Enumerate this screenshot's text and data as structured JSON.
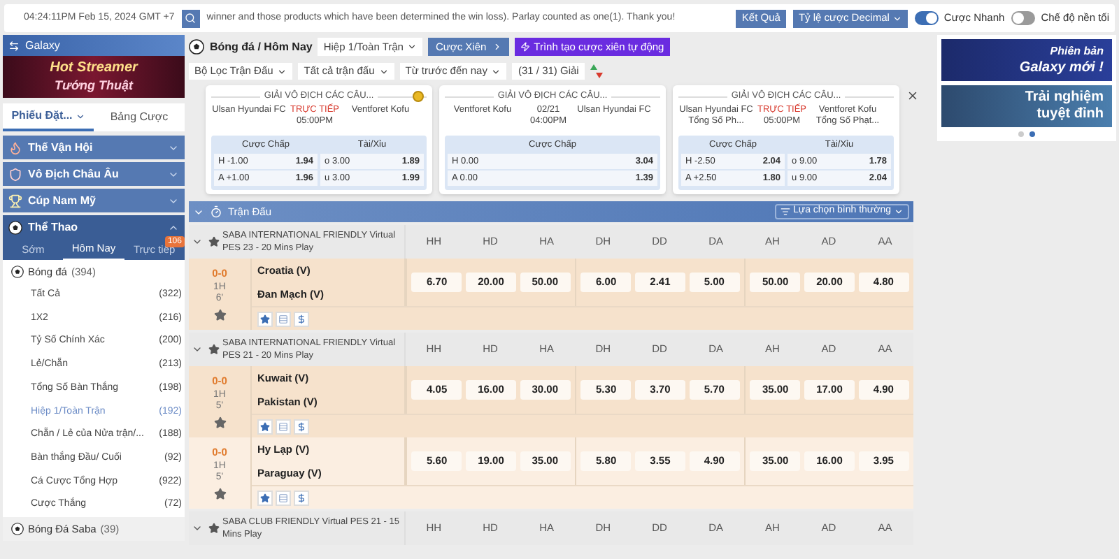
{
  "top_bar": {
    "time": "04:24:11PM Feb 15, 2024 GMT +7",
    "marquee": "winner and those products which have been determined the win loss). Parlay counted as one(1). Thank you!",
    "results_button": "Kết Quả",
    "odds_format": "Tỷ lệ cược Decimal",
    "toggles": [
      {
        "label": "Cược Nhanh",
        "on": true
      },
      {
        "label": "Chế độ nền tối",
        "on": false
      }
    ]
  },
  "left_banners": {
    "galaxy": "Galaxy",
    "streamer_line_1": "Hot Streamer",
    "streamer_line_2": "Tướng Thuật"
  },
  "sidebar": {
    "tabs": [
      {
        "label": "Phiếu Đặt...",
        "selected": true,
        "dropdown": true
      },
      {
        "label": "Bảng Cược",
        "selected": false,
        "dropdown": false
      }
    ],
    "sections": [
      {
        "label": "Thế Vận Hội",
        "kind": "flame",
        "expanded": false
      },
      {
        "label": "Vô Địch Châu Âu",
        "kind": "shield",
        "expanded": false
      },
      {
        "label": "Cúp Nam Mỹ",
        "kind": "trophy",
        "expanded": false
      },
      {
        "label": "Thể Thao",
        "kind": "ball",
        "expanded": true
      }
    ],
    "sport_tabs": [
      {
        "label": "Sớm",
        "selected": false
      },
      {
        "label": "Hôm Nay",
        "selected": true
      },
      {
        "label": "Trực tiếp",
        "selected": false,
        "badge": "106"
      }
    ],
    "sports": [
      {
        "label": "Bóng đá",
        "count": "(394)",
        "expanded": true,
        "children": [
          {
            "label": "Tất Cả",
            "count": "(322)",
            "selected": false
          },
          {
            "label": "1X2",
            "count": "(216)",
            "selected": false
          },
          {
            "label": "Tỷ Số Chính Xác",
            "count": "(200)",
            "selected": false
          },
          {
            "label": "Lẻ/Chẵn",
            "count": "(213)",
            "selected": false
          },
          {
            "label": "Tổng Số Bàn Thắng",
            "count": "(198)",
            "selected": false
          },
          {
            "label": "Hiệp 1/Toàn Trận",
            "count": "(192)",
            "selected": true
          },
          {
            "label": "Chẵn / Lẻ của Nửa trận/...",
            "count": "(188)",
            "selected": false
          },
          {
            "label": "Bàn thắng Đầu/ Cuối",
            "count": "(92)",
            "selected": false
          },
          {
            "label": "Cá Cược Tổng Hợp",
            "count": "(922)",
            "selected": false
          },
          {
            "label": "Cược Thắng",
            "count": "(72)",
            "selected": false
          }
        ]
      },
      {
        "label": "Bóng Đá Saba",
        "count": "(39)",
        "expanded": false
      }
    ]
  },
  "toolbar": {
    "breadcrumb": "Bóng đá / Hôm Nay",
    "period_select": "Hiệp 1/Toàn Trận",
    "parlay_button": "Cược Xiên",
    "auto_parlay_button": "Trình tạo cược xiên tự động"
  },
  "filters": [
    "Bộ Lọc Trận Đấu",
    "Tất cả trận đấu",
    "Từ trước đến nay"
  ],
  "league_count": "(31 / 31) Giải",
  "featured": [
    {
      "league": "GIẢI VÔ ĐỊCH CÁC CÂU...",
      "coin": true,
      "home": "Ulsan Hyundai FC",
      "away": "Ventforet Kofu",
      "status": "TRỰC TIẾP",
      "live": true,
      "time": "05:00PM",
      "markets": [
        {
          "title": "Cược Chấp",
          "rows": [
            {
              "side": "H",
              "line": "-1.00",
              "odds": "1.94"
            },
            {
              "side": "A",
              "line": "+1.00",
              "odds": "1.96"
            }
          ]
        },
        {
          "title": "Tài/Xỉu",
          "rows": [
            {
              "side": "o",
              "line": "3.00",
              "odds": "1.89"
            },
            {
              "side": "u",
              "line": "3.00",
              "odds": "1.99"
            }
          ]
        }
      ]
    },
    {
      "league": "GIẢI VÔ ĐỊCH CÁC CÂU...",
      "coin": false,
      "home": "Ventforet Kofu",
      "away": "Ulsan Hyundai FC",
      "status": "02/21",
      "live": false,
      "time": "04:00PM",
      "markets": [
        {
          "title": "Cược Chấp",
          "rows": [
            {
              "side": "H",
              "line": "0.00",
              "odds": "3.04"
            },
            {
              "side": "A",
              "line": "0.00",
              "odds": "1.39"
            }
          ]
        }
      ]
    },
    {
      "league": "GIẢI VÔ ĐỊCH CÁC CÂU...",
      "coin": false,
      "home": "Ulsan Hyundai FC Tổng Số Ph...",
      "away": "Ventforet Kofu Tổng Số Phạt...",
      "status": "TRỰC TIẾP",
      "live": true,
      "time": "05:00PM",
      "markets": [
        {
          "title": "Cược Chấp",
          "rows": [
            {
              "side": "H",
              "line": "-2.50",
              "odds": "2.04"
            },
            {
              "side": "A",
              "line": "+2.50",
              "odds": "1.80"
            }
          ]
        },
        {
          "title": "Tài/Xỉu",
          "rows": [
            {
              "side": "o",
              "line": "9.00",
              "odds": "1.78"
            },
            {
              "side": "u",
              "line": "9.00",
              "odds": "2.04"
            }
          ]
        }
      ]
    }
  ],
  "table": {
    "title": "Trận Đấu",
    "sort_select": "Lựa chọn bình thường",
    "leagues": [
      {
        "name": "SABA INTERNATIONAL FRIENDLY Virtual PES 23 - 20 Mins Play",
        "expanded": true,
        "columns": [
          "HH",
          "HD",
          "HA",
          "DH",
          "DD",
          "DA",
          "AH",
          "AD",
          "AA"
        ],
        "matches": [
          {
            "score": "0-0",
            "period": "1H",
            "minute": "6'",
            "home": "Croatia (V)",
            "away": "Đan Mạch (V)",
            "odds": [
              "6.70",
              "20.00",
              "50.00",
              "6.00",
              "2.41",
              "5.00",
              "50.00",
              "20.00",
              "4.80"
            ]
          }
        ]
      },
      {
        "name": "SABA INTERNATIONAL FRIENDLY Virtual PES 21 - 20 Mins Play",
        "expanded": true,
        "columns": [
          "HH",
          "HD",
          "HA",
          "DH",
          "DD",
          "DA",
          "AH",
          "AD",
          "AA"
        ],
        "matches": [
          {
            "score": "0-0",
            "period": "1H",
            "minute": "5'",
            "home": "Kuwait (V)",
            "away": "Pakistan (V)",
            "odds": [
              "4.05",
              "16.00",
              "30.00",
              "5.30",
              "3.70",
              "5.70",
              "35.00",
              "17.00",
              "4.90"
            ]
          },
          {
            "score": "0-0",
            "period": "1H",
            "minute": "5'",
            "home": "Hy Lạp (V)",
            "away": "Paraguay (V)",
            "odds": [
              "5.60",
              "19.00",
              "35.00",
              "5.80",
              "3.55",
              "4.90",
              "35.00",
              "16.00",
              "3.95"
            ]
          }
        ]
      },
      {
        "name": "SABA CLUB FRIENDLY Virtual PES 21 - 15 Mins Play",
        "expanded": true,
        "columns": [
          "HH",
          "HD",
          "HA",
          "DH",
          "DD",
          "DA",
          "AH",
          "AD",
          "AA"
        ]
      }
    ]
  },
  "right_banners": {
    "banner_1_line_1": "Phiên bản",
    "banner_1_line_2": "Galaxy mới !",
    "banner_2_line_1": "Trải nghiệm",
    "banner_2_line_2": "tuyệt đỉnh",
    "carousel_dots": [
      {
        "selected": false
      },
      {
        "selected": true
      }
    ]
  }
}
